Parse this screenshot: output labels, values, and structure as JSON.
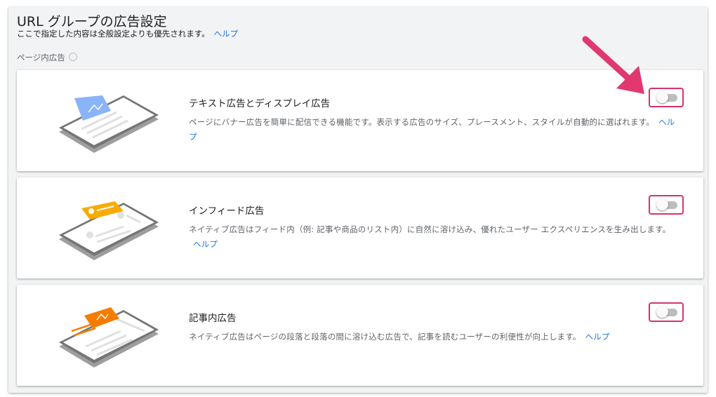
{
  "header": {
    "title": "URL グループの広告設定",
    "subtitle": "ここで指定した内容は全般設定よりも優先されます。",
    "help_link": "ヘルプ"
  },
  "section": {
    "label": "ページ内広告"
  },
  "cards": [
    {
      "title": "テキスト広告とディスプレイ広告",
      "description": "ページにバナー広告を簡単に配信できる機能です。表示する広告のサイズ、プレースメント、スタイルが自動的に選ばれます。",
      "help_link": "ヘルプ",
      "enabled": false,
      "accent": "#8ab4f8"
    },
    {
      "title": "インフィード広告",
      "description": "ネイティブ広告はフィード内（例: 記事や商品のリスト内）に自然に溶け込み、優れたユーザー エクスペリエンスを生み出します。",
      "help_link": "ヘルプ",
      "enabled": false,
      "accent": "#f9ab00"
    },
    {
      "title": "記事内広告",
      "description": "ネイティブ広告はページの段落と段落の間に溶け込む広告で、記事を読むユーザーの利便性が向上します。",
      "help_link": "ヘルプ",
      "enabled": false,
      "accent": "#f57c00"
    }
  ],
  "annotation": {
    "arrow_color": "#e0386f",
    "highlight_color": "#d6336c"
  }
}
